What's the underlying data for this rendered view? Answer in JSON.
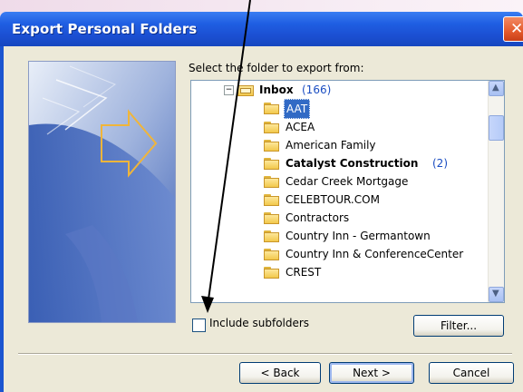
{
  "window": {
    "title": "Export Personal Folders"
  },
  "dialog": {
    "prompt": "Select the folder to export from:",
    "tree": {
      "root": {
        "label": "Inbox",
        "count": "(166)"
      },
      "items": [
        {
          "label": "AAT",
          "selected": true
        },
        {
          "label": "ACEA"
        },
        {
          "label": "American Family"
        },
        {
          "label": "Catalyst Construction",
          "bold": true,
          "count": "(2)"
        },
        {
          "label": "Cedar Creek Mortgage"
        },
        {
          "label": "CELEBTOUR.COM"
        },
        {
          "label": "Contractors"
        },
        {
          "label": "Country Inn - Germantown"
        },
        {
          "label": "Country Inn & ConferenceCenter"
        },
        {
          "label": "CREST"
        }
      ]
    },
    "include_subfolders": {
      "label": "Include subfolders",
      "checked": false
    },
    "buttons": {
      "filter": "Filter...",
      "back": "< Back",
      "next": "Next >",
      "cancel": "Cancel"
    }
  },
  "colors": {
    "title_bar": "#1f5ee2",
    "selection": "#316ac5",
    "count_blue": "#1a4dc2"
  }
}
